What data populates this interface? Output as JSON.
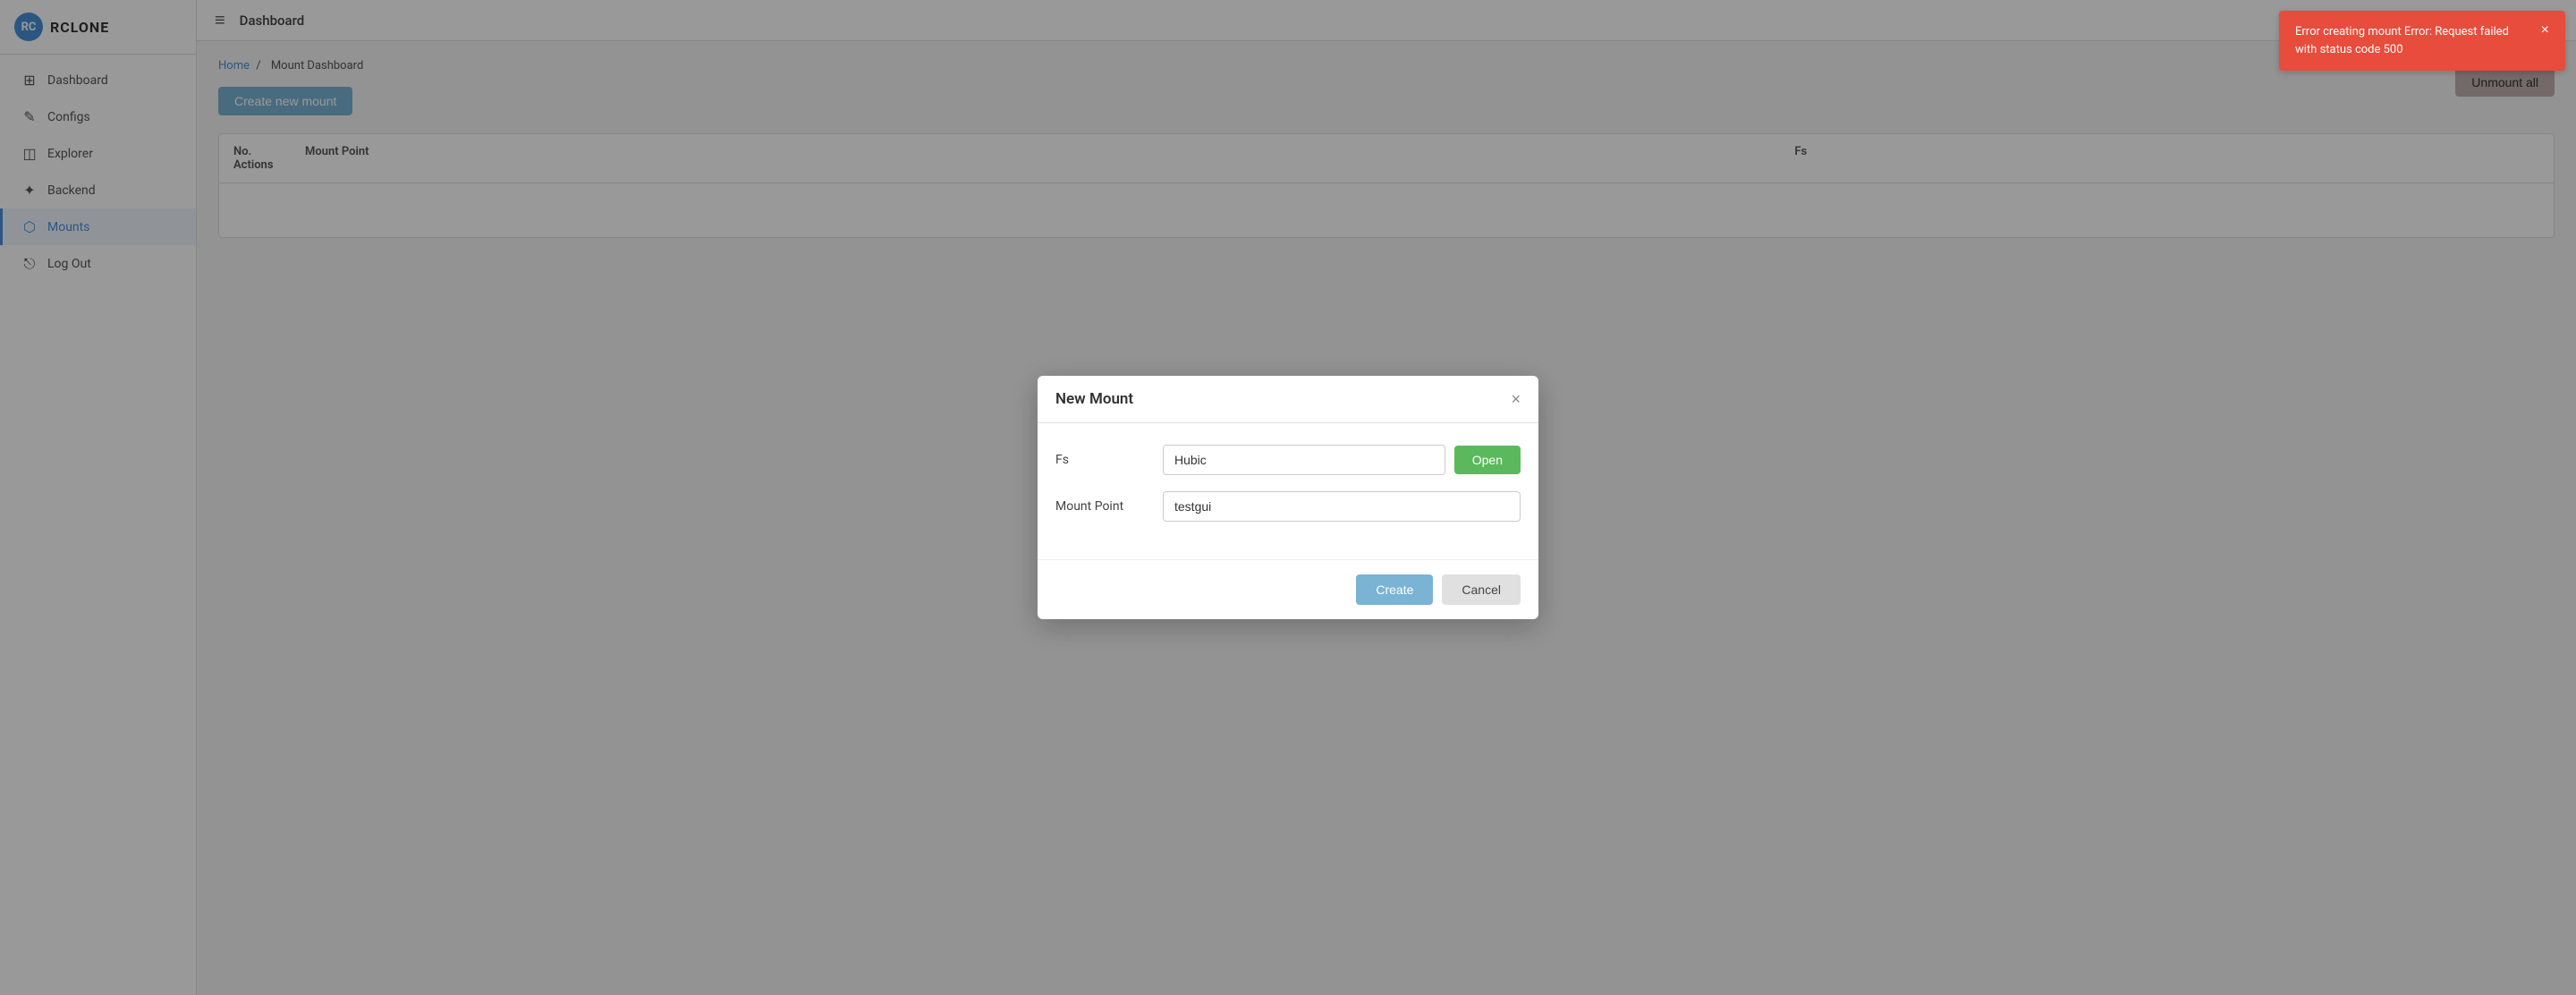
{
  "app": {
    "logo_text": "RCLONE",
    "topbar_title": "Dashboard"
  },
  "sidebar": {
    "items": [
      {
        "id": "dashboard",
        "label": "Dashboard",
        "icon": "⊞",
        "active": false
      },
      {
        "id": "configs",
        "label": "Configs",
        "icon": "✎",
        "active": false
      },
      {
        "id": "explorer",
        "label": "Explorer",
        "icon": "◫",
        "active": false
      },
      {
        "id": "backend",
        "label": "Backend",
        "icon": "✦",
        "active": false
      },
      {
        "id": "mounts",
        "label": "Mounts",
        "icon": "⬡",
        "active": true
      },
      {
        "id": "logout",
        "label": "Log Out",
        "icon": "⎋",
        "active": false
      }
    ]
  },
  "breadcrumb": {
    "home": "Home",
    "separator": "/",
    "current": "Mount Dashboard"
  },
  "page": {
    "create_button": "Create new mount",
    "unmount_all_button": "Unmount all"
  },
  "table": {
    "columns": [
      "No.",
      "Mount Point",
      "",
      "Fs",
      "Actions"
    ]
  },
  "modal": {
    "title": "New Mount",
    "close_symbol": "×",
    "fs_label": "Fs",
    "fs_value": "Hubic",
    "open_button": "Open",
    "mount_point_label": "Mount Point",
    "mount_point_value": "testgui",
    "create_button": "Create",
    "cancel_button": "Cancel"
  },
  "error_toast": {
    "message": "Error creating mount Error: Request failed with status code 500",
    "close_symbol": "×"
  }
}
